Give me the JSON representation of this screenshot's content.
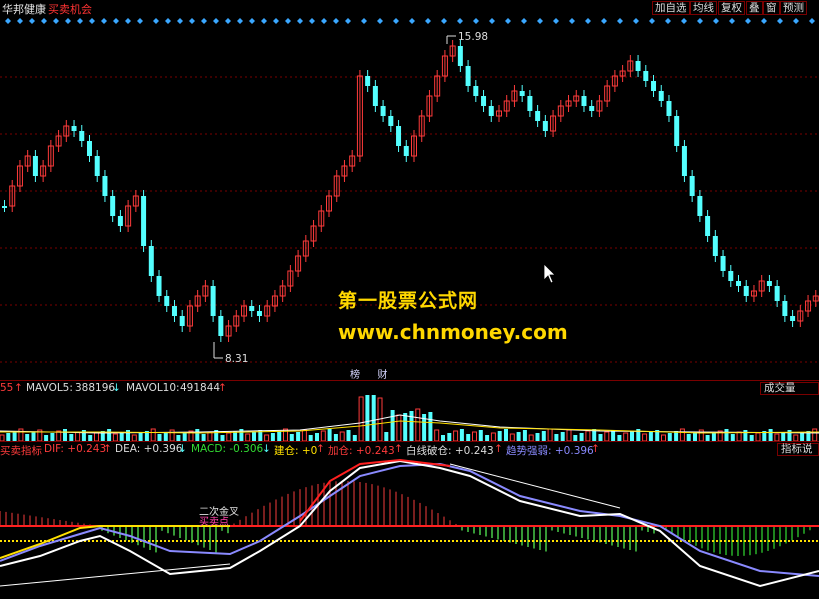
{
  "header": {
    "stock_name": "华邦健康",
    "signal_label": "买卖机会",
    "buttons": [
      "加自选",
      "均线",
      "复权",
      "叠",
      "窗",
      "预测"
    ]
  },
  "main_chart": {
    "high_label": "15.98",
    "low_label": "8.31"
  },
  "watermark": {
    "line1": "第一股票公式网",
    "line2": "www.chnmoney.com"
  },
  "event_badges": [
    "榜",
    "财"
  ],
  "volume_panel": {
    "cut_value": "55",
    "mavol5_label": "MAVOL5:",
    "mavol5_value": "388196",
    "mavol10_label": "MAVOL10:",
    "mavol10_value": "491844",
    "panel_button": "成交量"
  },
  "indicator_panel": {
    "name": "买卖指标",
    "dif": "DIF: +0.243",
    "dea": "DEA: +0.396",
    "macd": "MACD: -0.306",
    "jiancang": "建仓: +0",
    "jiacang": "加仓: +0.243",
    "baixian": "白线破仓: +0.243",
    "trend": "趋势强弱: +0.396",
    "panel_button": "指标说",
    "annotation_1": "二次金叉",
    "annotation_2": "买卖点"
  },
  "colors": {
    "up": "#ff3b3b",
    "down": "#54ffff",
    "gridline": "#7a0000",
    "diamond": "#3aa7ff",
    "watermark": "#ffd800"
  }
}
